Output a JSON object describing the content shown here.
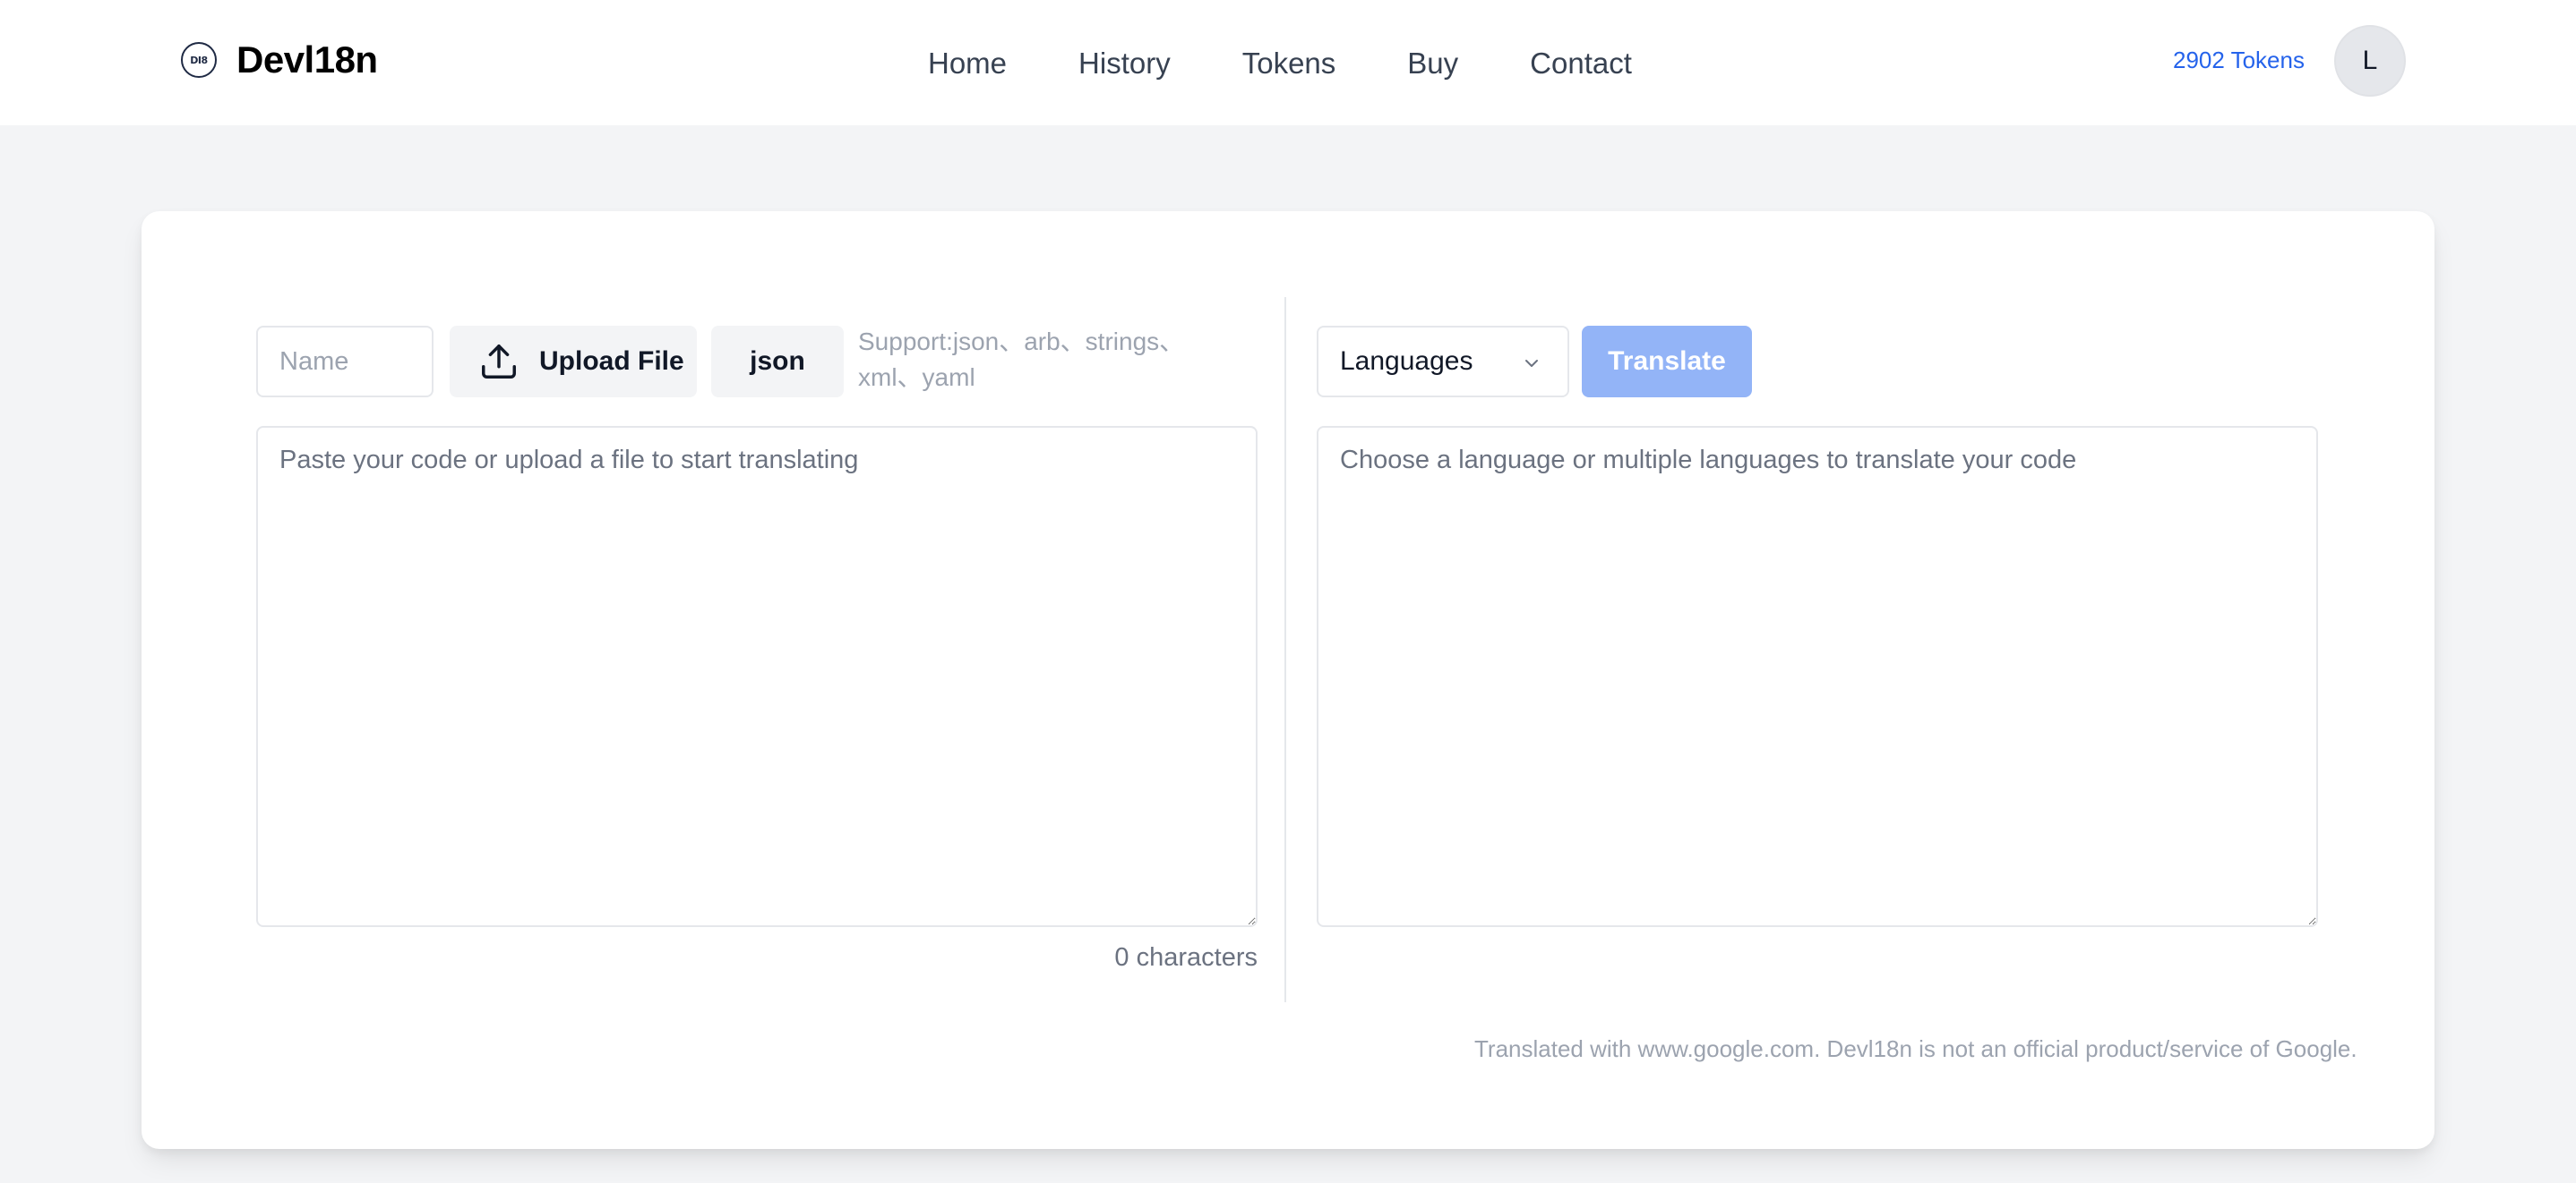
{
  "header": {
    "logo_text": "DI8",
    "brand_name": "Devl18n",
    "nav": [
      {
        "label": "Home"
      },
      {
        "label": "History"
      },
      {
        "label": "Tokens"
      },
      {
        "label": "Buy"
      },
      {
        "label": "Contact"
      }
    ],
    "tokens_label": "2902 Tokens",
    "avatar_initial": "L"
  },
  "source": {
    "name_placeholder": "Name",
    "upload_label": "Upload File",
    "upload_icon": "upload-icon",
    "format_label": "json",
    "support_text": "Support:json、arb、strings、xml、yaml",
    "textarea_placeholder": "Paste your code or upload a file to start translating",
    "char_count": "0 characters"
  },
  "target": {
    "languages_label": "Languages",
    "languages_icon": "chevron-down-icon",
    "translate_label": "Translate",
    "textarea_placeholder": "Choose a language or multiple languages to translate your code",
    "footnote": "Translated with www.google.com. Devl18n is not an official product/service of Google."
  },
  "colors": {
    "page_bg": "#f3f4f6",
    "accent_link": "#2563eb",
    "translate_disabled": "#93b4f7"
  }
}
